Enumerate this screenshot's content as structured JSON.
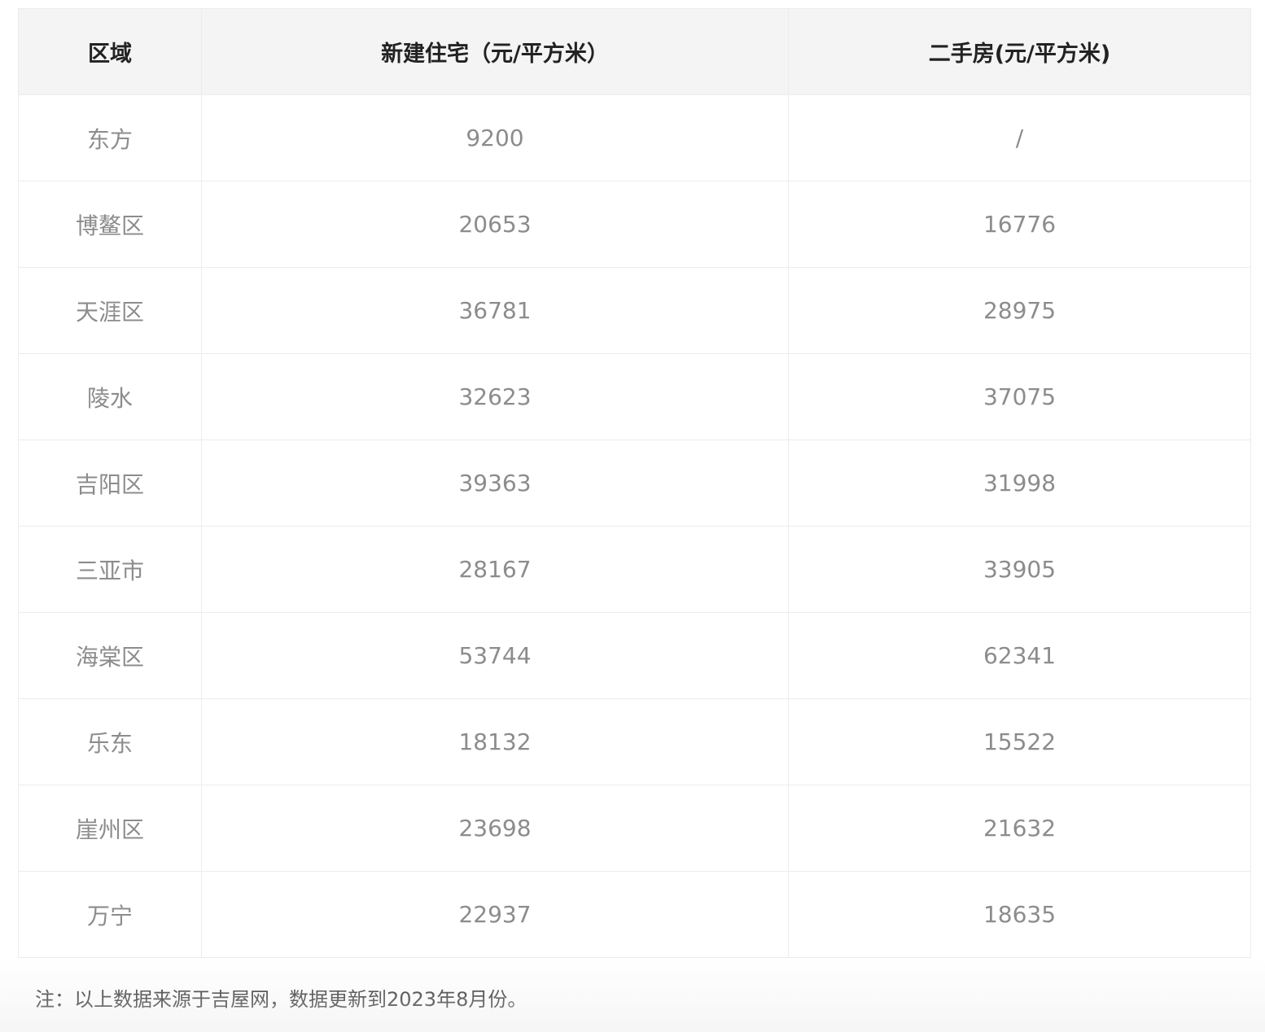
{
  "table": {
    "headers": [
      "区域",
      "新建住宅（元/平方米）",
      "二手房(元/平方米)"
    ],
    "rows": [
      [
        "东方",
        "9200",
        "/"
      ],
      [
        "博鳌区",
        "20653",
        "16776"
      ],
      [
        "天涯区",
        "36781",
        "28975"
      ],
      [
        "陵水",
        "32623",
        "37075"
      ],
      [
        "吉阳区",
        "39363",
        "31998"
      ],
      [
        "三亚市",
        "28167",
        "33905"
      ],
      [
        "海棠区",
        "53744",
        "62341"
      ],
      [
        "乐东",
        "18132",
        "15522"
      ],
      [
        "崖州区",
        "23698",
        "21632"
      ],
      [
        "万宁",
        "22937",
        "18635"
      ]
    ]
  },
  "note": "注：以上数据来源于吉屋网，数据更新到2023年8月份。"
}
